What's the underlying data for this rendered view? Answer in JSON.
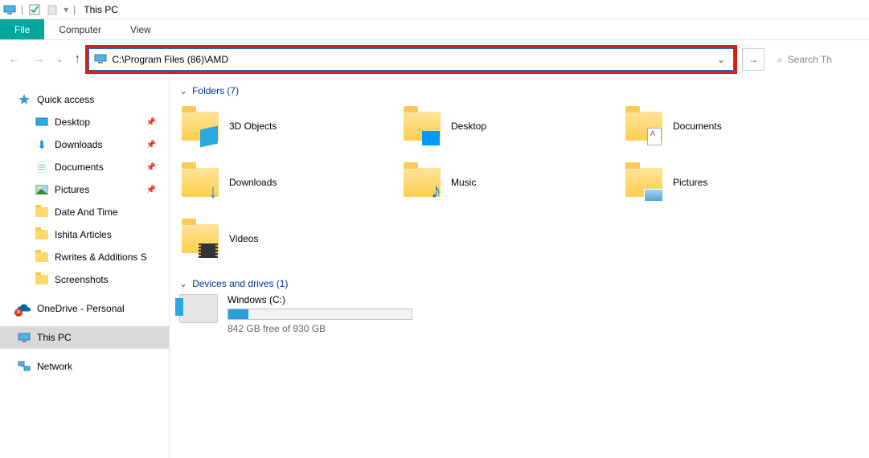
{
  "titlebar": {
    "title": "This PC"
  },
  "menubar": {
    "file": "File",
    "computer": "Computer",
    "view": "View"
  },
  "address": {
    "path": "C:\\Program Files (86)\\AMD"
  },
  "search": {
    "placeholder": "Search Th"
  },
  "sidebar": {
    "quick_access": "Quick access",
    "items": [
      {
        "label": "Desktop",
        "pinned": true
      },
      {
        "label": "Downloads",
        "pinned": true
      },
      {
        "label": "Documents",
        "pinned": true
      },
      {
        "label": "Pictures",
        "pinned": true
      },
      {
        "label": "Date And Time",
        "pinned": false
      },
      {
        "label": "Ishita Articles",
        "pinned": false
      },
      {
        "label": "Rwrites & Additions S",
        "pinned": false
      },
      {
        "label": "Screenshots",
        "pinned": false
      }
    ],
    "onedrive": "OneDrive - Personal",
    "thispc": "This PC",
    "network": "Network"
  },
  "content": {
    "folders_header": "Folders (7)",
    "folders": [
      {
        "label": "3D Objects"
      },
      {
        "label": "Desktop"
      },
      {
        "label": "Documents"
      },
      {
        "label": "Downloads"
      },
      {
        "label": "Music"
      },
      {
        "label": "Pictures"
      },
      {
        "label": "Videos"
      }
    ],
    "drives_header": "Devices and drives (1)",
    "drive": {
      "label": "Windows (C:)",
      "free_text": "842 GB free of 930 GB",
      "used_pct": 11
    }
  }
}
